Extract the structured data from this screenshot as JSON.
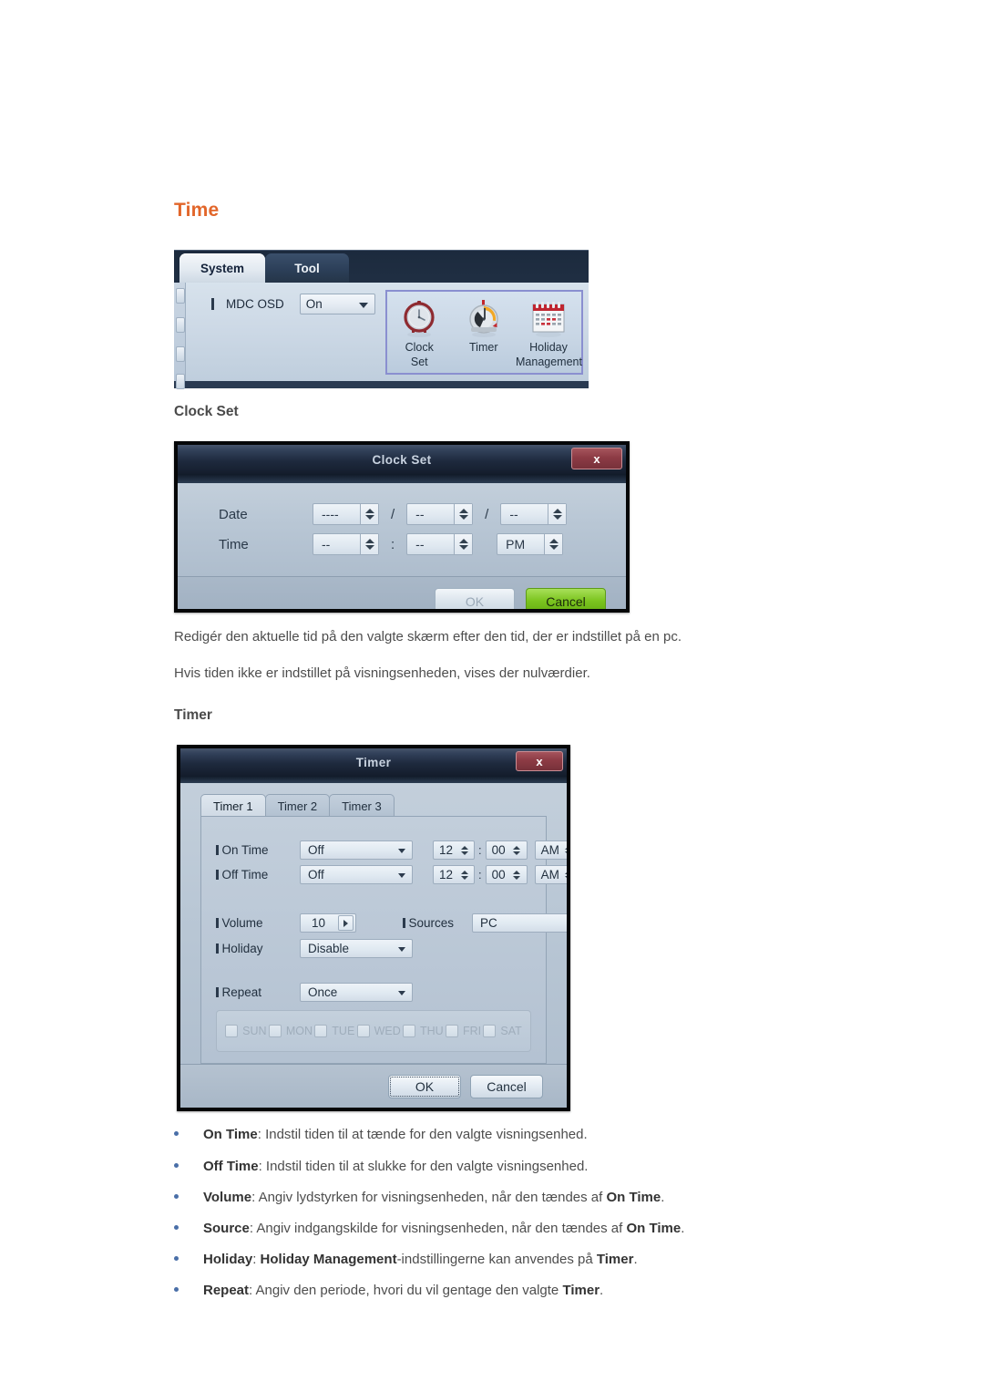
{
  "page": {
    "section_title": "Time",
    "accent_color": "#e2662a",
    "subheading_clock": "Clock Set",
    "subheading_timer": "Timer",
    "paragraphs": [
      "Redigér den aktuelle tid på den valgte skærm efter den tid, der er indstillet på en pc.",
      "Hvis tiden ikke er indstillet på visningsenheden, vises der nulværdier."
    ]
  },
  "mdc_panel": {
    "tabs": [
      {
        "label": "System",
        "active": true
      },
      {
        "label": "Tool",
        "active": false
      }
    ],
    "field": {
      "label": "MDC OSD",
      "value": "On"
    },
    "icons": [
      {
        "name": "clock-set-icon",
        "caption_line1": "Clock",
        "caption_line2": "Set"
      },
      {
        "name": "timer-icon",
        "caption_line1": "Timer",
        "caption_line2": ""
      },
      {
        "name": "holiday-management-icon",
        "caption_line1": "Holiday",
        "caption_line2": "Management"
      }
    ]
  },
  "clock_set_dialog": {
    "title": "Clock Set",
    "close_label": "x",
    "date_label": "Date",
    "time_label": "Time",
    "date": {
      "year": "----",
      "month": "--",
      "day": "--",
      "sep": "/"
    },
    "time": {
      "hour": "--",
      "minute": "--",
      "meridiem": "PM",
      "sep": ":"
    },
    "buttons": {
      "ok": "OK",
      "cancel": "Cancel"
    }
  },
  "timer_dialog": {
    "title": "Timer",
    "close_label": "x",
    "tabs": [
      {
        "label": "Timer 1",
        "selected": true
      },
      {
        "label": "Timer 2",
        "selected": false
      },
      {
        "label": "Timer 3",
        "selected": false
      }
    ],
    "on_time": {
      "label": "On Time",
      "state": "Off",
      "hour": "12",
      "minute": "00",
      "meridiem": "AM",
      "sep": ":"
    },
    "off_time": {
      "label": "Off Time",
      "state": "Off",
      "hour": "12",
      "minute": "00",
      "meridiem": "AM",
      "sep": ":"
    },
    "volume": {
      "label": "Volume",
      "value": "10"
    },
    "sources": {
      "label": "Sources",
      "value": "PC"
    },
    "holiday": {
      "label": "Holiday",
      "value": "Disable"
    },
    "repeat": {
      "label": "Repeat",
      "value": "Once"
    },
    "days": [
      "SUN",
      "MON",
      "TUE",
      "WED",
      "THU",
      "FRI",
      "SAT"
    ],
    "buttons": {
      "ok": "OK",
      "cancel": "Cancel"
    }
  },
  "bullets": [
    {
      "term": "On Time",
      "rest": ": Indstil tiden til at tænde for den valgte visningsenhed.",
      "tail_bold": "",
      "tail": ""
    },
    {
      "term": "Off Time",
      "rest": ": Indstil tiden til at slukke for den valgte visningsenhed.",
      "tail_bold": "",
      "tail": ""
    },
    {
      "term": "Volume",
      "rest": ": Angiv lydstyrken for visningsenheden, når den tændes af ",
      "tail_bold": "On Time",
      "tail": "."
    },
    {
      "term": "Source",
      "rest": ": Angiv indgangskilde for visningsenheden, når den tændes af ",
      "tail_bold": "On Time",
      "tail": "."
    },
    {
      "term": "Holiday",
      "rest": ": ",
      "mid_bold": "Holiday Management",
      "rest2": "-indstillingerne kan anvendes på ",
      "tail_bold": "Timer",
      "tail": "."
    },
    {
      "term": "Repeat",
      "rest": ": Angiv den periode, hvori du vil gentage den valgte ",
      "tail_bold": "Timer",
      "tail": "."
    }
  ]
}
